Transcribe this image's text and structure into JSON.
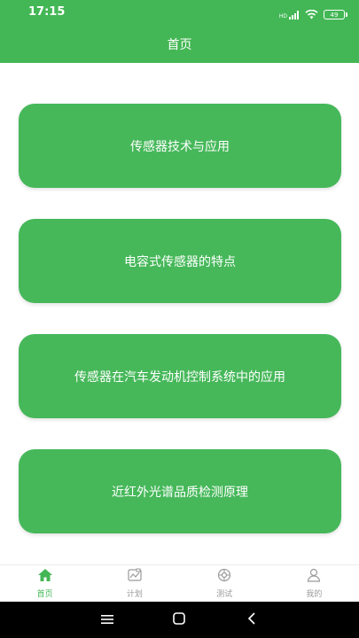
{
  "status_bar": {
    "time": "17:15",
    "network_label": "HD",
    "battery": "49"
  },
  "header": {
    "title": "首页"
  },
  "cards": [
    {
      "label": "传感器技术与应用"
    },
    {
      "label": "电容式传感器的特点"
    },
    {
      "label": "传感器在汽车发动机控制系统中的应用"
    },
    {
      "label": "近红外光谱品质检测原理"
    }
  ],
  "tabs": [
    {
      "label": "首页",
      "icon": "home-icon",
      "active": true
    },
    {
      "label": "计划",
      "icon": "plan-icon",
      "active": false
    },
    {
      "label": "测试",
      "icon": "test-icon",
      "active": false
    },
    {
      "label": "我的",
      "icon": "profile-icon",
      "active": false
    }
  ],
  "colors": {
    "accent": "#43b755",
    "card": "#46b85a",
    "tab_inactive": "#9a9a9a"
  }
}
